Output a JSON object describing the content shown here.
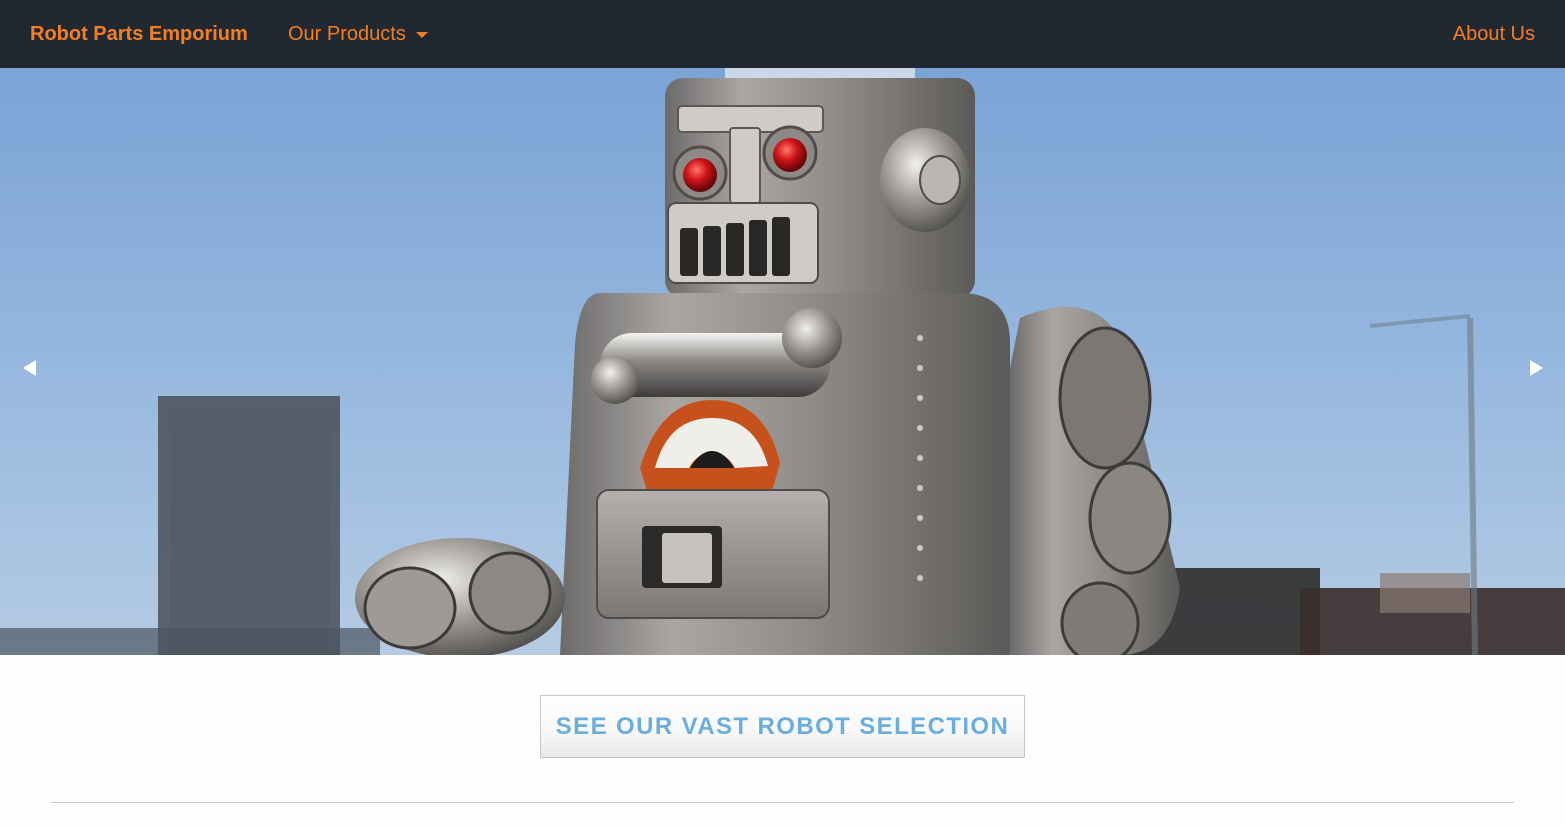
{
  "navbar": {
    "brand": "Robot Parts Emporium",
    "products_label": "Our Products",
    "about_label": "About Us",
    "accent_color": "#f47f23",
    "background_color": "#222831"
  },
  "carousel": {
    "prev_icon": "triangle-left",
    "next_icon": "triangle-right",
    "image_subject": "tin-toy-robot"
  },
  "cta": {
    "label": "SEE OUR VAST ROBOT SELECTION",
    "text_color": "#6aaee0"
  }
}
